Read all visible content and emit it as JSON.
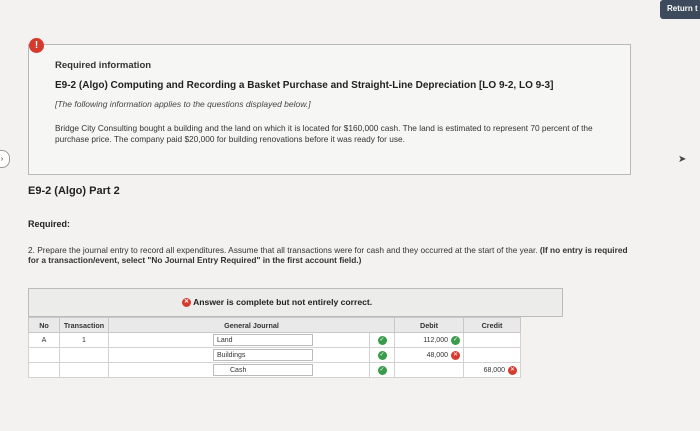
{
  "header": {
    "return_label": "Return t"
  },
  "info": {
    "heading": "Required information",
    "title": "E9-2 (Algo) Computing and Recording a Basket Purchase and Straight-Line Depreciation [LO 9-2, LO 9-3]",
    "note": "[The following information applies to the questions displayed below.]",
    "body": "Bridge City Consulting bought a building and the land on which it is located for $160,000 cash. The land is estimated to represent 70 percent of the purchase price. The company paid $20,000 for building renovations before it was ready for use."
  },
  "part": {
    "title": "E9-2 (Algo) Part 2",
    "required_label": "Required:",
    "instruction_main": "2. Prepare the journal entry to record all expenditures. Assume that all transactions were for cash and they occurred at the start of the year. ",
    "instruction_bold": "(If no entry is required for a transaction/event, select \"No Journal Entry Required\" in the first account field.)"
  },
  "answer": {
    "banner": "Answer is complete but not entirely correct.",
    "columns": {
      "no": "No",
      "transaction": "Transaction",
      "general_journal": "General Journal",
      "debit": "Debit",
      "credit": "Credit"
    },
    "rows": [
      {
        "no": "A",
        "transaction": "1",
        "account": "Land",
        "debit": "112,000",
        "credit": ""
      },
      {
        "no": "",
        "transaction": "",
        "account": "Buildings",
        "debit": "48,000",
        "credit": ""
      },
      {
        "no": "",
        "transaction": "",
        "account": "Cash",
        "debit": "",
        "credit": "68,000"
      }
    ]
  }
}
